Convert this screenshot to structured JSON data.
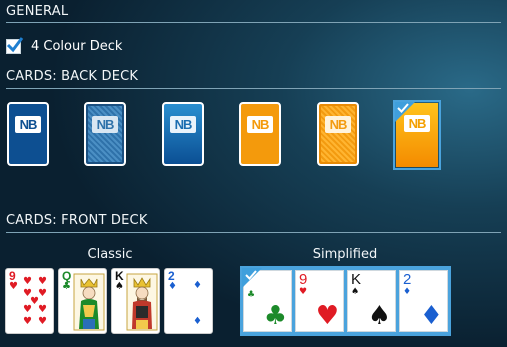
{
  "general": {
    "title": "GENERAL"
  },
  "four_colour": {
    "label": "4 Colour Deck",
    "checked": true
  },
  "back_deck": {
    "title": "CARDS: BACK DECK",
    "logo_text": "NB",
    "cards": [
      {
        "name": "blue-solid",
        "selected": false
      },
      {
        "name": "blue-pattern",
        "selected": false
      },
      {
        "name": "blue-gradient",
        "selected": false
      },
      {
        "name": "orange-solid",
        "selected": false
      },
      {
        "name": "orange-pattern",
        "selected": false
      },
      {
        "name": "orange-gradient",
        "selected": true
      }
    ]
  },
  "front_deck": {
    "title": "CARDS: FRONT DECK",
    "classic": {
      "label": "Classic",
      "selected": false,
      "cards": [
        {
          "rank": "9",
          "suit": "♥",
          "color": "red"
        },
        {
          "rank": "Q",
          "suit": "♣",
          "color": "green"
        },
        {
          "rank": "K",
          "suit": "♠",
          "color": "black"
        },
        {
          "rank": "2",
          "suit": "♦",
          "color": "blue"
        }
      ]
    },
    "simplified": {
      "label": "Simplified",
      "selected": true,
      "cards": [
        {
          "rank": "",
          "suit": "♣",
          "color": "green"
        },
        {
          "rank": "9",
          "suit": "♥",
          "color": "red"
        },
        {
          "rank": "K",
          "suit": "♠",
          "color": "black"
        },
        {
          "rank": "2",
          "suit": "♦",
          "color": "blue"
        }
      ]
    }
  },
  "colors": {
    "selection": "#4aa3dd",
    "red_suit": "#e01b24",
    "green_suit": "#1c8a2a",
    "blue_suit": "#1a5fd0"
  }
}
